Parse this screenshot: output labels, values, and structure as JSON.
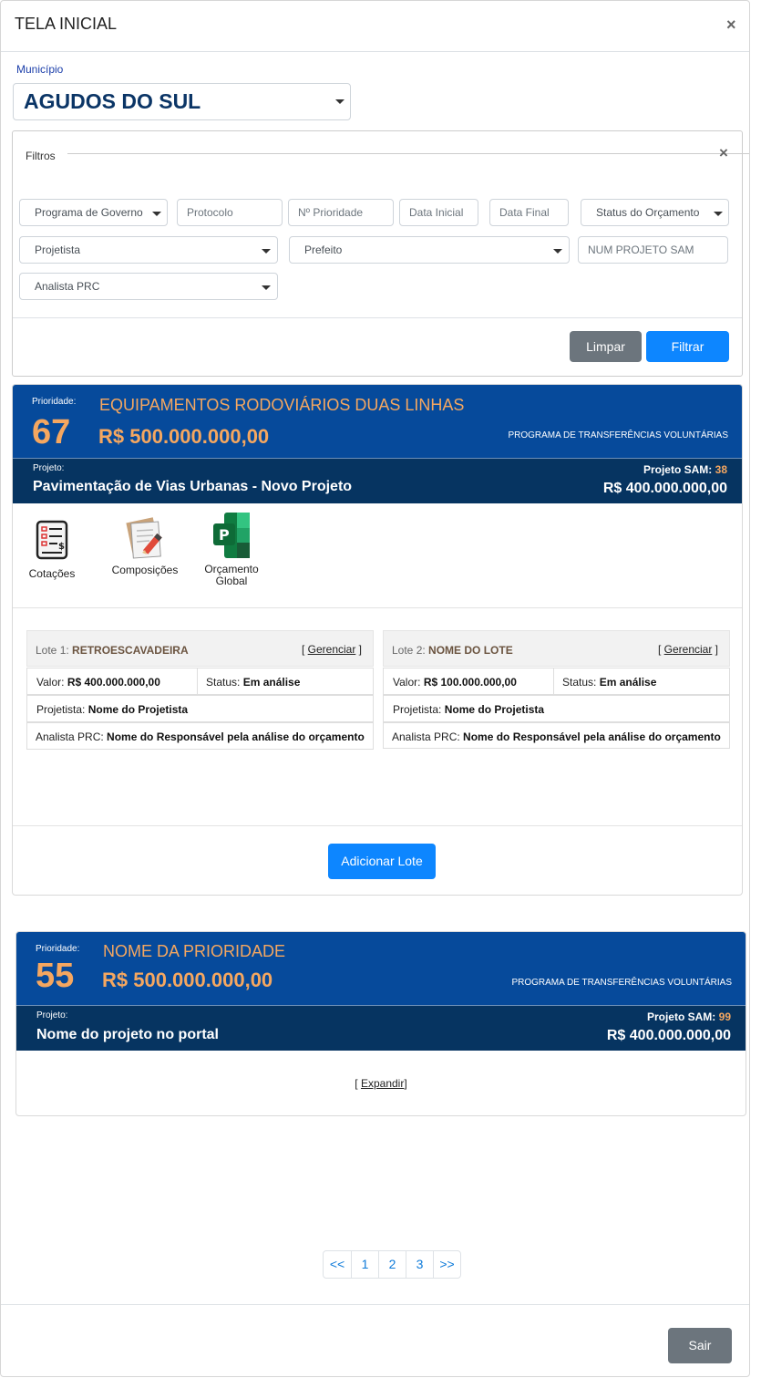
{
  "modal": {
    "title": "TELA INICIAL",
    "close": "×"
  },
  "municipio": {
    "label": "Município",
    "value": "AGUDOS DO SUL"
  },
  "filters": {
    "legend": "Filtros",
    "close": "×",
    "programa": "Programa de Governo",
    "protocolo": "Protocolo",
    "prioridade": "Nº Prioridade",
    "data_inicial": "Data Inicial",
    "data_final": "Data Final",
    "status": "Status do Orçamento",
    "projetista": "Projetista",
    "prefeito": "Prefeito",
    "num_projeto": "NUM PROJETO SAM",
    "analista": "Analista PRC",
    "clear_label": "Limpar",
    "filter_label": "Filtrar"
  },
  "cards": [
    {
      "prio_label": "Prioridade:",
      "prio_number": "67",
      "title": "EQUIPAMENTOS RODOVIÁRIOS DUAS LINHAS",
      "value": "R$ 500.000.000,00",
      "program": "PROGRAMA DE TRANSFERÊNCIAS VOLUNTÁRIAS",
      "project_label": "Projeto:",
      "project_name": "Pavimentação de Vias Urbanas - Novo Projeto",
      "sam_label": "Projeto SAM:",
      "sam_number": "38",
      "project_value": "R$ 400.000.000,00",
      "tools": {
        "cotacoes": "Cotações",
        "composicoes": "Composições",
        "orcamento_1": "Orçamento",
        "orcamento_2": "Global"
      },
      "lotes": [
        {
          "prefix": "Lote 1:",
          "name": "RETROESCAVADEIRA",
          "manage": "Gerenciar",
          "valor_label": "Valor:",
          "valor": "R$ 400.000.000,00",
          "status_label": "Status:",
          "status": "Em análise",
          "projetista_label": "Projetista:",
          "projetista": "Nome do Projetista",
          "analista_label": "Analista PRC:",
          "analista": "Nome do Responsável pela análise do orçamento"
        },
        {
          "prefix": "Lote 2:",
          "name": "NOME DO LOTE",
          "manage": "Gerenciar",
          "valor_label": "Valor:",
          "valor": "R$ 100.000.000,00",
          "status_label": "Status:",
          "status": "Em análise",
          "projetista_label": "Projetista:",
          "projetista": "Nome do Projetista",
          "analista_label": "Analista PRC:",
          "analista": "Nome do Responsável pela análise do orçamento"
        }
      ],
      "add_lote": "Adicionar Lote"
    },
    {
      "prio_label": "Prioridade:",
      "prio_number": "55",
      "title": "NOME DA PRIORIDADE",
      "value": "R$ 500.000.000,00",
      "program": "PROGRAMA DE TRANSFERÊNCIAS VOLUNTÁRIAS",
      "project_label": "Projeto:",
      "project_name": "Nome do projeto no portal",
      "sam_label": "Projeto SAM:",
      "sam_number": "99",
      "project_value": "R$ 400.000.000,00",
      "expand": "Expandir"
    }
  ],
  "pagination": [
    "<<",
    "1",
    "2",
    "3",
    ">>"
  ],
  "exit_label": "Sair",
  "colors": {
    "header_blue": "#064a9b",
    "sub_blue": "#063461",
    "accent_orange": "#f5a760",
    "primary": "#0d86ff"
  },
  "icons": [
    "close-icon",
    "chevron-down-icon",
    "quotation-icon",
    "composition-icon",
    "ms-project-icon"
  ]
}
